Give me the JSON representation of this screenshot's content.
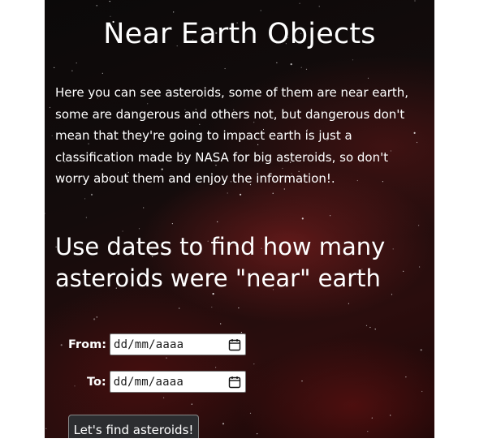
{
  "page": {
    "title": "Near Earth Objects",
    "intro": "Here you can see asteroids, some of them are near earth, some are dangerous and others not, but dangerous don't mean that they're going to impact earth is just a classification made by NASA for big asteroids, so don't worry about them and enjoy the information!.",
    "subtitle": "Use dates to find how many asteroids were \"near\" earth"
  },
  "form": {
    "from_label": "From:",
    "from_value": "dd/mm/aaaa",
    "to_label": "To:",
    "to_value": "dd/mm/aaaa",
    "submit_label": "Let's find asteroids!",
    "icons": [
      "calendar-icon",
      "calendar-icon"
    ]
  },
  "colors": {
    "background": "#140c0c",
    "accent_red": "#962323",
    "button_bg": "#2c2d30",
    "text": "#ffffff"
  }
}
